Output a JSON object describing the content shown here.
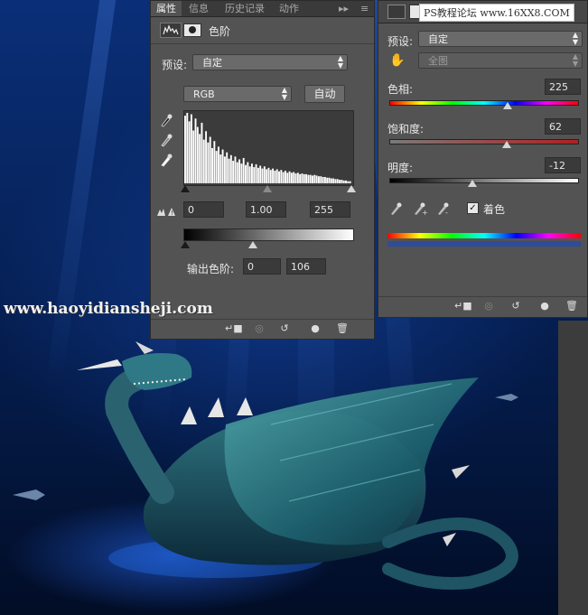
{
  "watermarks": {
    "top_right": "PS教程论坛 www.16XX8.COM",
    "left": "www.haoyidiansheji.com"
  },
  "levels_panel": {
    "tabs": [
      {
        "label": "属性",
        "active": true
      },
      {
        "label": "信息",
        "active": false
      },
      {
        "label": "历史记录",
        "active": false
      },
      {
        "label": "动作",
        "active": false
      }
    ],
    "title": "色阶",
    "preset_label": "预设:",
    "preset_value": "自定",
    "channel_value": "RGB",
    "auto_label": "自动",
    "input_levels": {
      "black": "0",
      "gamma": "1.00",
      "white": "255"
    },
    "output_label": "输出色阶:",
    "output_levels": {
      "black": "0",
      "white": "106"
    },
    "histogram": [
      96,
      100,
      88,
      98,
      75,
      92,
      80,
      70,
      86,
      62,
      74,
      58,
      66,
      50,
      60,
      46,
      52,
      41,
      48,
      38,
      44,
      35,
      40,
      32,
      38,
      30,
      34,
      28,
      36,
      26,
      30,
      24,
      28,
      23,
      27,
      22,
      25,
      21,
      24,
      20,
      22,
      19,
      21,
      18,
      20,
      17,
      19,
      16,
      18,
      15,
      17,
      15,
      16,
      14,
      15,
      13,
      14,
      13,
      13,
      12,
      12,
      11,
      12,
      11,
      10,
      10,
      9,
      9,
      8,
      8,
      7,
      7,
      6,
      6,
      5,
      5,
      4,
      4,
      3,
      3
    ]
  },
  "hue_panel": {
    "preset_label": "预设:",
    "preset_value": "自定",
    "range_value": "全图",
    "hue_label": "色相:",
    "hue_value": "225",
    "saturation_label": "饱和度:",
    "saturation_value": "62",
    "lightness_label": "明度:",
    "lightness_value": "-12",
    "colorize_label": "着色",
    "colorize_checked": true
  },
  "colors": {
    "panel_bg": "#535353",
    "tab_bar": "#3a3a3a",
    "field_bg": "#3a3a3a",
    "scene_blue": "#07245e"
  },
  "icons": [
    "histogram-icon",
    "mask-icon",
    "eyedropper-icon",
    "hand-icon",
    "clip-icon",
    "visibility-icon",
    "reset-icon",
    "eye-icon",
    "trash-icon",
    "warning-icon",
    "panel-menu-icon"
  ]
}
